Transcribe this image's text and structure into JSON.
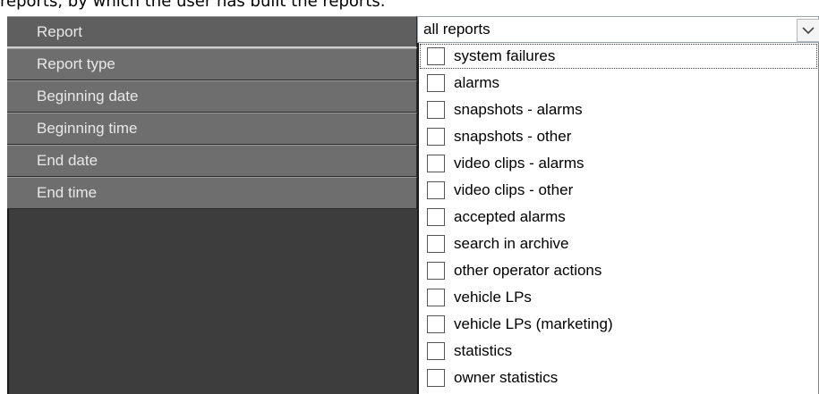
{
  "caption": "reports, by which the user has built the reports.",
  "fields": [
    {
      "label": "Report"
    },
    {
      "label": "Report type"
    },
    {
      "label": "Beginning date"
    },
    {
      "label": "Beginning time"
    },
    {
      "label": "End date"
    },
    {
      "label": "End time"
    }
  ],
  "report_combo": {
    "value": "all reports",
    "options": [
      {
        "label": "system failures",
        "checked": false
      },
      {
        "label": "alarms",
        "checked": false
      },
      {
        "label": "snapshots - alarms",
        "checked": false
      },
      {
        "label": "snapshots - other",
        "checked": false
      },
      {
        "label": "video clips - alarms",
        "checked": false
      },
      {
        "label": "video clips - other",
        "checked": false
      },
      {
        "label": "accepted alarms",
        "checked": false
      },
      {
        "label": "search in archive",
        "checked": false
      },
      {
        "label": "other operator actions",
        "checked": false
      },
      {
        "label": "vehicle LPs",
        "checked": false
      },
      {
        "label": "vehicle LPs (marketing)",
        "checked": false
      },
      {
        "label": "statistics",
        "checked": false
      },
      {
        "label": "owner statistics",
        "checked": false
      }
    ]
  }
}
